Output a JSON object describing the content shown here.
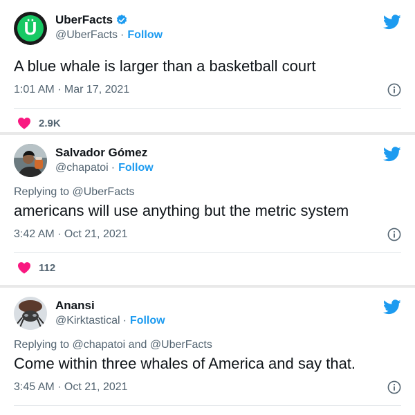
{
  "colors": {
    "brand_blue": "#1d9bf0",
    "heart_pink": "#f91880",
    "uberfacts_green": "#18c964",
    "text_secondary": "#536471"
  },
  "follow_label": "Follow",
  "tweets": [
    {
      "name": "UberFacts",
      "verified": true,
      "handle": "@UberFacts",
      "text": "A blue whale is larger than a basketball court",
      "time": "1:01 AM · Mar 17, 2021",
      "likes": "2.9K",
      "avatar_icon": "uberfacts-u-logo",
      "avatar_letter": "Ü"
    },
    {
      "name": "Salvador Gómez",
      "handle": "@chapatoi",
      "reply_to": "Replying to @UberFacts",
      "text": "americans will use anything but the metric system",
      "time": "3:42 AM · Oct 21, 2021",
      "likes": "112",
      "avatar_icon": "person-photo"
    },
    {
      "name": "Anansi",
      "handle": "@Kirktastical",
      "reply_to": "Replying to @chapatoi and @UberFacts",
      "text": "Come within three whales of America and say that.",
      "time": "3:45 AM · Oct 21, 2021",
      "avatar_icon": "spider-photo"
    }
  ]
}
